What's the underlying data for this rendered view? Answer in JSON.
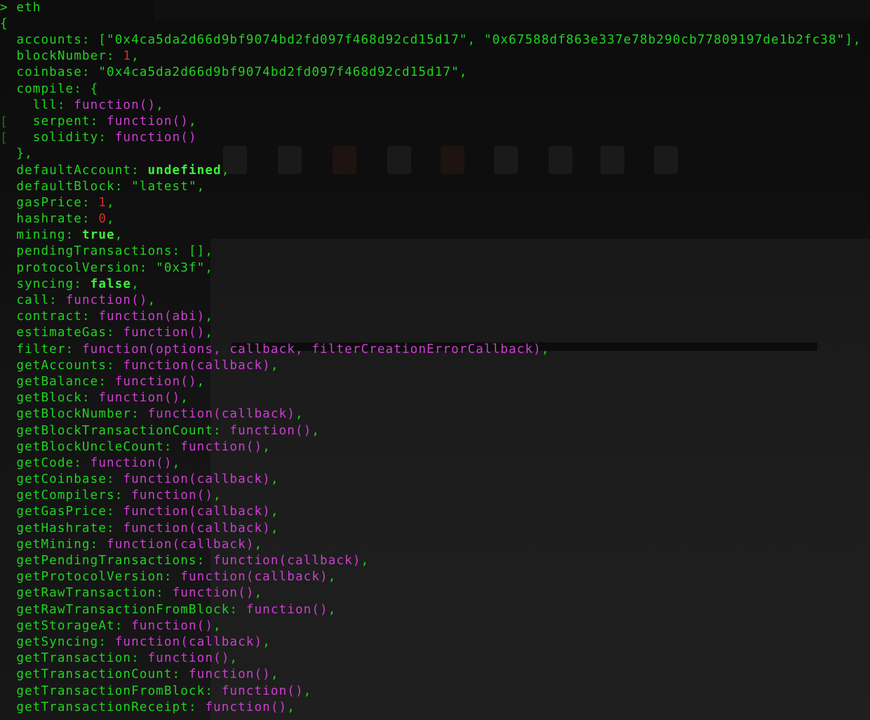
{
  "terminal": {
    "prompt_symbol": ">",
    "command": "eth",
    "open_brace": "{",
    "gutter_marks": [
      "[",
      "["
    ],
    "lines": [
      {
        "key": "accounts",
        "parts": [
          {
            "t": "punct",
            "v": "["
          },
          {
            "t": "str",
            "v": "\"0x4ca5da2d66d9bf9074bd2fd097f468d92cd15d17\""
          },
          {
            "t": "punct",
            "v": ", "
          },
          {
            "t": "str",
            "v": "\"0x67588df863e337e78b290cb77809197de1b2fc38\""
          },
          {
            "t": "punct",
            "v": "],"
          }
        ]
      },
      {
        "key": "blockNumber",
        "parts": [
          {
            "t": "num",
            "v": "1"
          },
          {
            "t": "punct",
            "v": ","
          }
        ]
      },
      {
        "key": "coinbase",
        "parts": [
          {
            "t": "str",
            "v": "\"0x4ca5da2d66d9bf9074bd2fd097f468d92cd15d17\""
          },
          {
            "t": "punct",
            "v": ","
          }
        ]
      },
      {
        "key": "compile",
        "parts": [
          {
            "t": "punct",
            "v": "{"
          }
        ]
      },
      {
        "key": "lll",
        "indent": 2,
        "parts": [
          {
            "t": "fn",
            "v": "function()"
          },
          {
            "t": "punct",
            "v": ","
          }
        ]
      },
      {
        "key": "serpent",
        "indent": 2,
        "parts": [
          {
            "t": "fn",
            "v": "function()"
          },
          {
            "t": "punct",
            "v": ","
          }
        ]
      },
      {
        "key": "solidity",
        "indent": 2,
        "parts": [
          {
            "t": "fn",
            "v": "function()"
          }
        ]
      },
      {
        "raw": "},"
      },
      {
        "key": "defaultAccount",
        "parts": [
          {
            "t": "bool",
            "v": "undefined"
          },
          {
            "t": "punct",
            "v": ","
          }
        ]
      },
      {
        "key": "defaultBlock",
        "parts": [
          {
            "t": "str",
            "v": "\"latest\""
          },
          {
            "t": "punct",
            "v": ","
          }
        ]
      },
      {
        "key": "gasPrice",
        "parts": [
          {
            "t": "num",
            "v": "1"
          },
          {
            "t": "punct",
            "v": ","
          }
        ]
      },
      {
        "key": "hashrate",
        "parts": [
          {
            "t": "num",
            "v": "0"
          },
          {
            "t": "punct",
            "v": ","
          }
        ]
      },
      {
        "key": "mining",
        "parts": [
          {
            "t": "bool",
            "v": "true"
          },
          {
            "t": "punct",
            "v": ","
          }
        ]
      },
      {
        "key": "pendingTransactions",
        "parts": [
          {
            "t": "punct",
            "v": "[],"
          }
        ]
      },
      {
        "key": "protocolVersion",
        "parts": [
          {
            "t": "str",
            "v": "\"0x3f\""
          },
          {
            "t": "punct",
            "v": ","
          }
        ]
      },
      {
        "key": "syncing",
        "parts": [
          {
            "t": "bool",
            "v": "false"
          },
          {
            "t": "punct",
            "v": ","
          }
        ]
      },
      {
        "key": "call",
        "parts": [
          {
            "t": "fn",
            "v": "function()"
          },
          {
            "t": "punct",
            "v": ","
          }
        ]
      },
      {
        "key": "contract",
        "parts": [
          {
            "t": "fn",
            "v": "function(abi)"
          },
          {
            "t": "punct",
            "v": ","
          }
        ]
      },
      {
        "key": "estimateGas",
        "parts": [
          {
            "t": "fn",
            "v": "function()"
          },
          {
            "t": "punct",
            "v": ","
          }
        ]
      },
      {
        "key": "filter",
        "parts": [
          {
            "t": "fn",
            "v": "function(options, callback, filterCreationErrorCallback)"
          },
          {
            "t": "punct",
            "v": ","
          }
        ]
      },
      {
        "key": "getAccounts",
        "parts": [
          {
            "t": "fn",
            "v": "function(callback)"
          },
          {
            "t": "punct",
            "v": ","
          }
        ]
      },
      {
        "key": "getBalance",
        "parts": [
          {
            "t": "fn",
            "v": "function()"
          },
          {
            "t": "punct",
            "v": ","
          }
        ]
      },
      {
        "key": "getBlock",
        "parts": [
          {
            "t": "fn",
            "v": "function()"
          },
          {
            "t": "punct",
            "v": ","
          }
        ]
      },
      {
        "key": "getBlockNumber",
        "parts": [
          {
            "t": "fn",
            "v": "function(callback)"
          },
          {
            "t": "punct",
            "v": ","
          }
        ]
      },
      {
        "key": "getBlockTransactionCount",
        "parts": [
          {
            "t": "fn",
            "v": "function()"
          },
          {
            "t": "punct",
            "v": ","
          }
        ]
      },
      {
        "key": "getBlockUncleCount",
        "parts": [
          {
            "t": "fn",
            "v": "function()"
          },
          {
            "t": "punct",
            "v": ","
          }
        ]
      },
      {
        "key": "getCode",
        "parts": [
          {
            "t": "fn",
            "v": "function()"
          },
          {
            "t": "punct",
            "v": ","
          }
        ]
      },
      {
        "key": "getCoinbase",
        "parts": [
          {
            "t": "fn",
            "v": "function(callback)"
          },
          {
            "t": "punct",
            "v": ","
          }
        ]
      },
      {
        "key": "getCompilers",
        "parts": [
          {
            "t": "fn",
            "v": "function()"
          },
          {
            "t": "punct",
            "v": ","
          }
        ]
      },
      {
        "key": "getGasPrice",
        "parts": [
          {
            "t": "fn",
            "v": "function(callback)"
          },
          {
            "t": "punct",
            "v": ","
          }
        ]
      },
      {
        "key": "getHashrate",
        "parts": [
          {
            "t": "fn",
            "v": "function(callback)"
          },
          {
            "t": "punct",
            "v": ","
          }
        ]
      },
      {
        "key": "getMining",
        "parts": [
          {
            "t": "fn",
            "v": "function(callback)"
          },
          {
            "t": "punct",
            "v": ","
          }
        ]
      },
      {
        "key": "getPendingTransactions",
        "parts": [
          {
            "t": "fn",
            "v": "function(callback)"
          },
          {
            "t": "punct",
            "v": ","
          }
        ]
      },
      {
        "key": "getProtocolVersion",
        "parts": [
          {
            "t": "fn",
            "v": "function(callback)"
          },
          {
            "t": "punct",
            "v": ","
          }
        ]
      },
      {
        "key": "getRawTransaction",
        "parts": [
          {
            "t": "fn",
            "v": "function()"
          },
          {
            "t": "punct",
            "v": ","
          }
        ]
      },
      {
        "key": "getRawTransactionFromBlock",
        "parts": [
          {
            "t": "fn",
            "v": "function()"
          },
          {
            "t": "punct",
            "v": ","
          }
        ]
      },
      {
        "key": "getStorageAt",
        "parts": [
          {
            "t": "fn",
            "v": "function()"
          },
          {
            "t": "punct",
            "v": ","
          }
        ]
      },
      {
        "key": "getSyncing",
        "parts": [
          {
            "t": "fn",
            "v": "function(callback)"
          },
          {
            "t": "punct",
            "v": ","
          }
        ]
      },
      {
        "key": "getTransaction",
        "parts": [
          {
            "t": "fn",
            "v": "function()"
          },
          {
            "t": "punct",
            "v": ","
          }
        ]
      },
      {
        "key": "getTransactionCount",
        "parts": [
          {
            "t": "fn",
            "v": "function()"
          },
          {
            "t": "punct",
            "v": ","
          }
        ]
      },
      {
        "key": "getTransactionFromBlock",
        "parts": [
          {
            "t": "fn",
            "v": "function()"
          },
          {
            "t": "punct",
            "v": ","
          }
        ]
      },
      {
        "key": "getTransactionReceipt",
        "parts": [
          {
            "t": "fn",
            "v": "function()"
          },
          {
            "t": "punct",
            "v": ","
          }
        ]
      }
    ]
  },
  "colors": {
    "background": "#0b0b0b",
    "key_text": "#1fd51f",
    "number": "#d0302a",
    "function": "#cc3fd0",
    "keyword_bold": "#3cf23c"
  }
}
